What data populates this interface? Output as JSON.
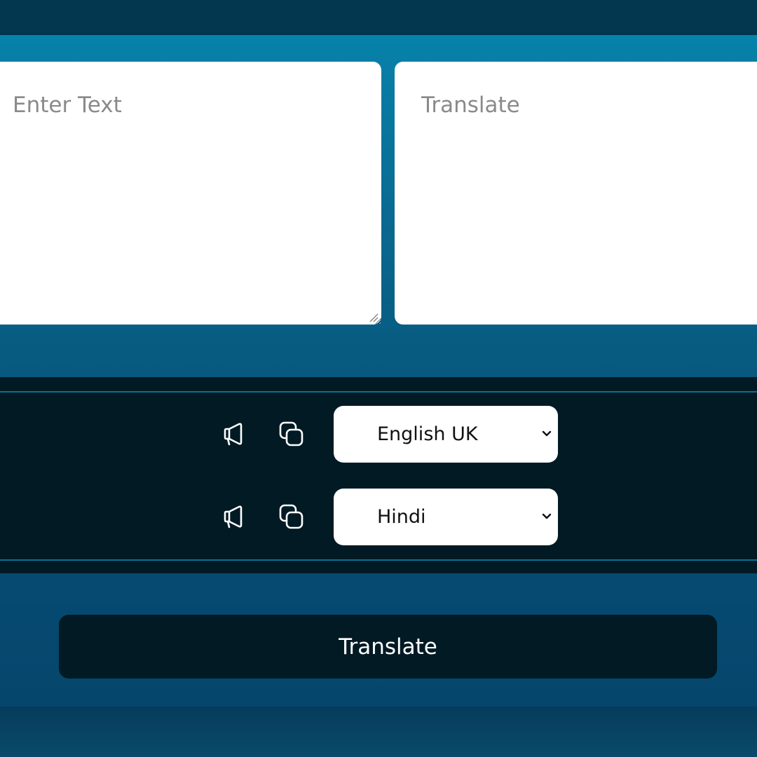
{
  "source": {
    "placeholder": "Enter Text",
    "value": ""
  },
  "target": {
    "placeholder": "Translate",
    "value": ""
  },
  "from": {
    "speak_icon": "megaphone-icon",
    "copy_icon": "copy-icon",
    "selected_language": "English UK"
  },
  "to": {
    "speak_icon": "megaphone-icon",
    "copy_icon": "copy-icon",
    "selected_language": "Hindi"
  },
  "action": {
    "translate_label": "Translate"
  },
  "colors": {
    "panel_top": "#0782aa",
    "panel_bottom": "#05466c",
    "dark_band": "#011a24",
    "accent_line": "#0a6f93"
  }
}
